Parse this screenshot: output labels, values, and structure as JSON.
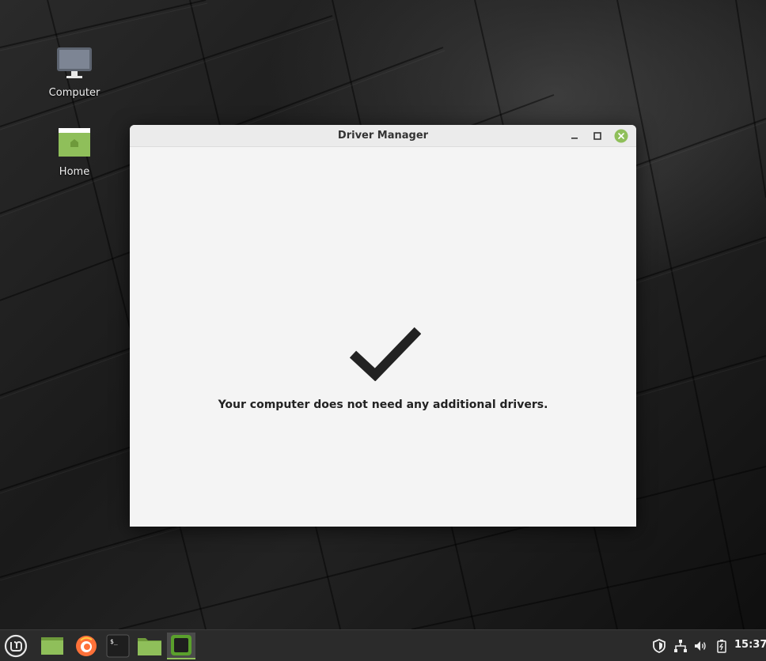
{
  "desktop": {
    "icons": [
      {
        "label": "Computer"
      },
      {
        "label": "Home"
      }
    ]
  },
  "window": {
    "title": "Driver Manager",
    "message": "Your computer does not need any additional drivers.",
    "controls": [
      "minimize-icon",
      "maximize-icon",
      "close-icon"
    ]
  },
  "taskbar": {
    "items": [
      "mint-menu-icon",
      "show-desktop-icon",
      "firefox-icon",
      "terminal-icon",
      "files-icon",
      "driver-manager-icon"
    ],
    "tray": [
      "shield-icon",
      "network-icon",
      "volume-icon",
      "battery-icon"
    ],
    "clock": "15:37"
  },
  "colors": {
    "accent": "#8fbf5a",
    "window_bg": "#f4f4f4",
    "titlebar_bg": "#ebebeb",
    "taskbar_bg": "#2b2b2b"
  }
}
